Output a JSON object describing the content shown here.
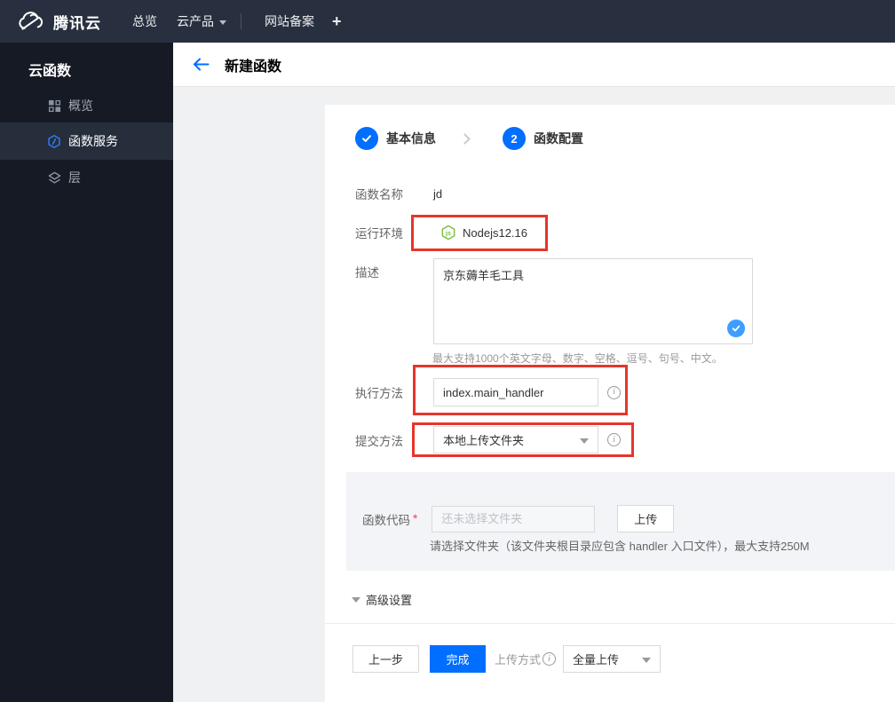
{
  "navbar": {
    "brand": "腾讯云",
    "items": [
      {
        "id": "overview",
        "label": "总览"
      },
      {
        "id": "products",
        "label": "云产品"
      },
      {
        "id": "beian",
        "label": "网站备案"
      },
      {
        "id": "add",
        "label": "+"
      }
    ]
  },
  "sidebar": {
    "title": "云函数",
    "items": [
      {
        "id": "overview",
        "label": "概览",
        "icon": "grid-icon",
        "active": false
      },
      {
        "id": "function-service",
        "label": "函数服务",
        "icon": "function-hexagon-icon",
        "active": true
      },
      {
        "id": "layers",
        "label": "层",
        "icon": "layers-icon",
        "active": false
      }
    ]
  },
  "page_header": {
    "title": "新建函数"
  },
  "stepper": {
    "steps": [
      {
        "number": "1",
        "label": "基本信息",
        "state": "completed"
      },
      {
        "number": "2",
        "label": "函数配置",
        "state": "current"
      }
    ]
  },
  "form": {
    "function_name": {
      "label": "函数名称",
      "value": "jd"
    },
    "runtime": {
      "label": "运行环境",
      "value": "Nodejs12.16",
      "icon": "nodejs-icon"
    },
    "description": {
      "label": "描述",
      "value": "京东薅羊毛工具",
      "hint": "最大支持1000个英文字母、数字、空格、逗号、句号、中文。"
    },
    "handler": {
      "label": "执行方法",
      "value": "index.main_handler"
    },
    "submit_method": {
      "label": "提交方法",
      "value": "本地上传文件夹"
    },
    "function_code": {
      "label": "函数代码",
      "required_mark": "*",
      "placeholder": "还未选择文件夹",
      "upload_button": "上传",
      "hint": "请选择文件夹（该文件夹根目录应包含 handler 入口文件），最大支持250M"
    },
    "advanced_settings": {
      "label": "高级设置"
    }
  },
  "footer": {
    "prev_button": "上一步",
    "finish_button": "完成",
    "upload_mode_label": "上传方式",
    "upload_mode_value": "全量上传"
  },
  "colors": {
    "accent_blue": "#006eff",
    "annotation_red": "#e6352b",
    "nodejs_green": "#7fbe42",
    "textarea_check_blue": "#3f9dff",
    "navbar_bg": "#28303f",
    "sidebar_bg": "#151a24"
  }
}
